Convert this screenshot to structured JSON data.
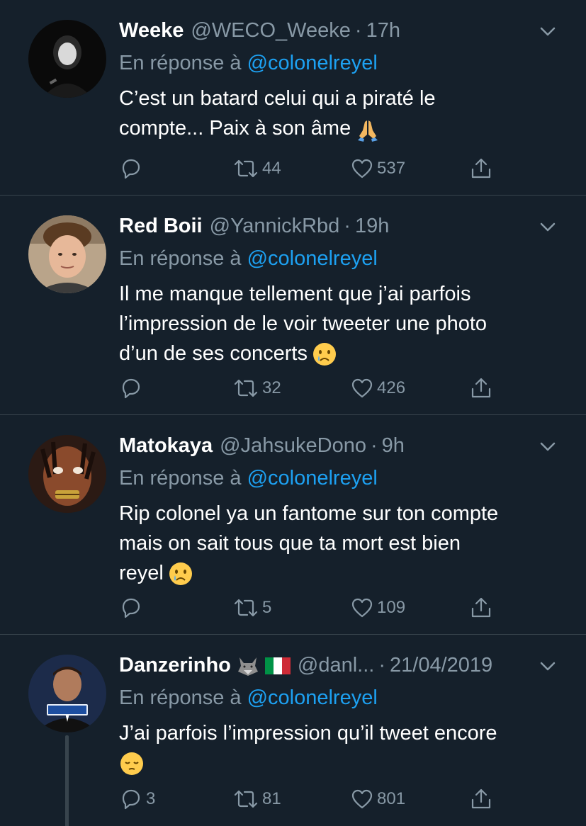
{
  "tweets": [
    {
      "display_name": "Weeke",
      "handle": "@WECO_Weeke",
      "time": "17h",
      "reply_prefix": "En réponse à",
      "reply_to": "@colonelreyel",
      "text": "C’est un batard celui qui a piraté le\ncompte... Paix à son âme",
      "emoji": "praying-hands",
      "reply_count": "",
      "retweet_count": "44",
      "like_count": "537"
    },
    {
      "display_name": "Red Boii",
      "handle": "@YannickRbd",
      "time": "19h",
      "reply_prefix": "En réponse à",
      "reply_to": "@colonelreyel",
      "text": "Il me manque tellement que j’ai parfois\nl’impression de le voir tweeter une photo\nd’un de ses concerts",
      "emoji": "crying-face",
      "reply_count": "",
      "retweet_count": "32",
      "like_count": "426"
    },
    {
      "display_name": "Matokaya",
      "handle": "@JahsukeDono",
      "time": "9h",
      "reply_prefix": "En réponse à",
      "reply_to": "@colonelreyel",
      "text": "Rip colonel ya un fantome sur ton compte\nmais on sait tous que ta mort est bien\nreyel",
      "emoji": "crying-face",
      "reply_count": "",
      "retweet_count": "5",
      "like_count": "109"
    },
    {
      "display_name": "Danzerinho",
      "handle": "@danl...",
      "time": "21/04/2019",
      "reply_prefix": "En réponse à",
      "reply_to": "@colonelreyel",
      "text": "J’ai parfois l’impression qu’il tweet encore",
      "emoji": "pensive-face",
      "reply_count": "3",
      "retweet_count": "81",
      "like_count": "801"
    }
  ],
  "separator": "·",
  "colors": {
    "background": "#15202b",
    "secondary_text": "#8899a6",
    "accent": "#1da1f2",
    "divider": "#38444d"
  }
}
